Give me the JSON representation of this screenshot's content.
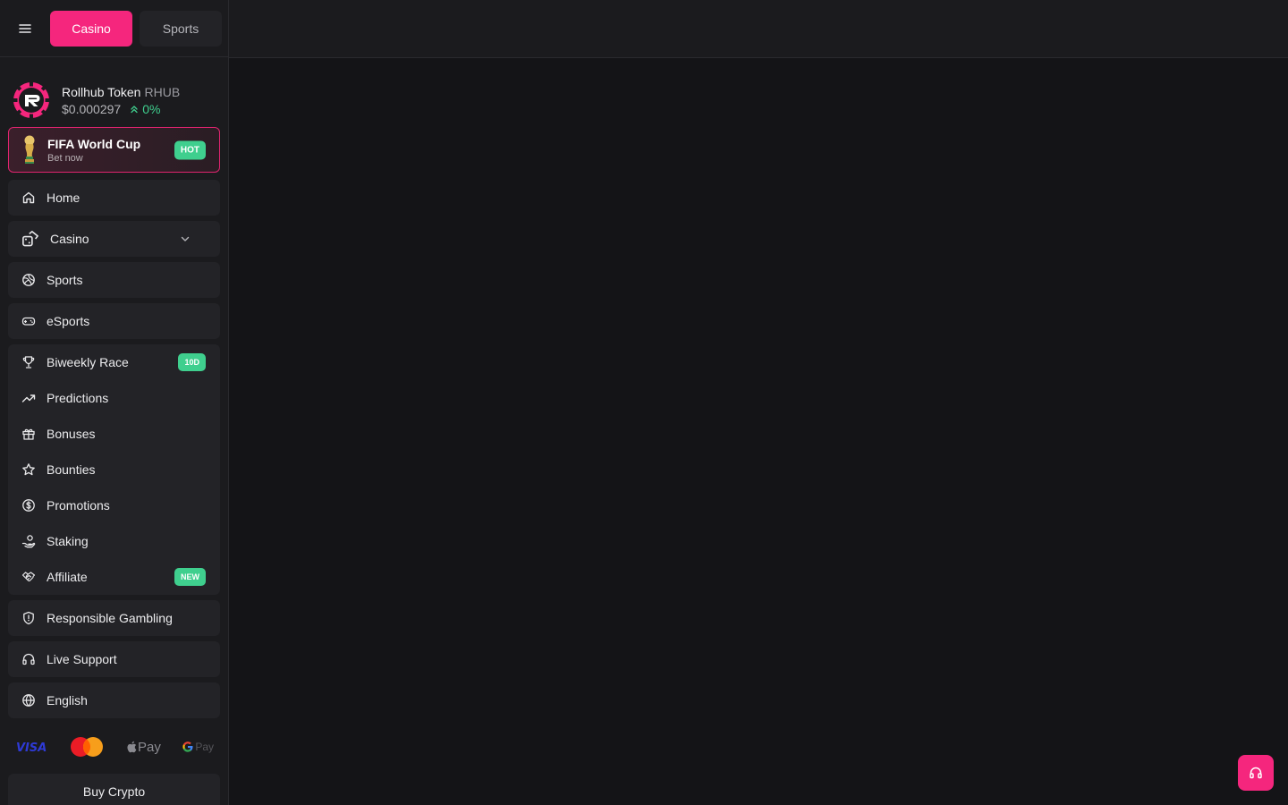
{
  "header": {
    "tabs": [
      {
        "label": "Casino",
        "active": true
      },
      {
        "label": "Sports",
        "active": false
      }
    ]
  },
  "token": {
    "name": "Rollhub Token",
    "symbol": "RHUB",
    "price": "$0.000297",
    "change": "0%"
  },
  "promo": {
    "title": "FIFA World Cup",
    "subtitle": "Bet now",
    "badge": "HOT"
  },
  "menu": {
    "home": "Home",
    "casino": "Casino",
    "sports": "Sports",
    "esports": "eSports",
    "race": "Biweekly Race",
    "race_badge": "10D",
    "predictions": "Predictions",
    "bonuses": "Bonuses",
    "bounties": "Bounties",
    "promotions": "Promotions",
    "staking": "Staking",
    "affiliate": "Affiliate",
    "affiliate_badge": "NEW",
    "responsible": "Responsible Gambling",
    "live_support": "Live Support",
    "language": "English"
  },
  "payments": {
    "visa": "VISA",
    "apple_pay": "Pay",
    "google_pay": "Pay"
  },
  "buy_crypto": "Buy Crypto",
  "colors": {
    "accent": "#f5267d",
    "success": "#3fcf8e",
    "sidebar_bg": "#1b1b1e",
    "main_bg": "#141417"
  }
}
